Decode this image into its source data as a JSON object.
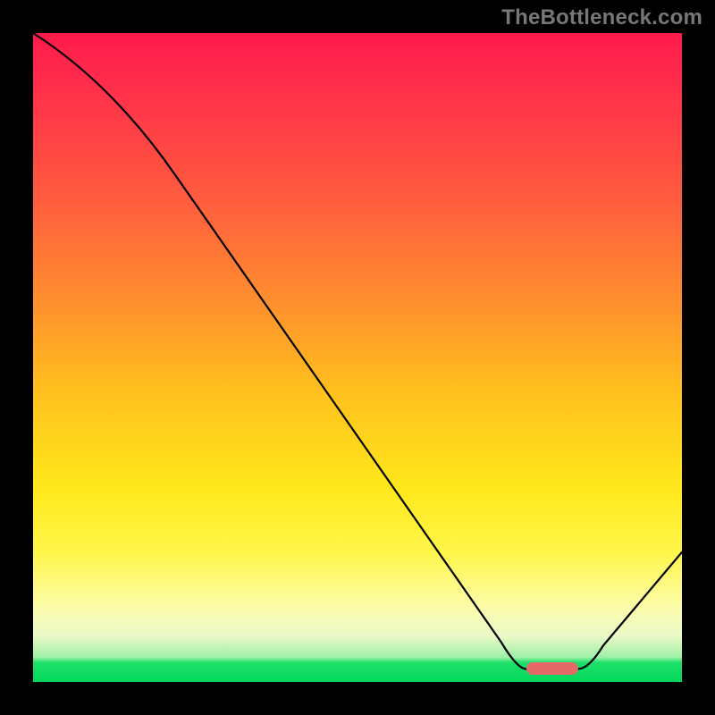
{
  "watermark": "TheBottleneck.com",
  "colors": {
    "frame_bg": "#000000",
    "gradient_top": "#ff1a4b",
    "gradient_mid1": "#ff8a2f",
    "gradient_mid2": "#ffe81b",
    "gradient_pale": "#fbfcb0",
    "gradient_green": "#00d85c",
    "curve": "#000000",
    "marker": "#e36a68"
  },
  "chart_data": {
    "type": "line",
    "title": "",
    "xlabel": "",
    "ylabel": "",
    "xlim": [
      0,
      100
    ],
    "ylim": [
      0,
      100
    ],
    "x": [
      0,
      22,
      76,
      84,
      100
    ],
    "values": [
      100,
      78,
      2,
      2,
      20
    ],
    "marker": {
      "x_start": 76,
      "x_end": 84,
      "y": 2,
      "width_pct": 8
    },
    "note": "y=100 at top (red), y=0 at bottom (green); minimum plateau near x≈76–84 at y≈2"
  }
}
